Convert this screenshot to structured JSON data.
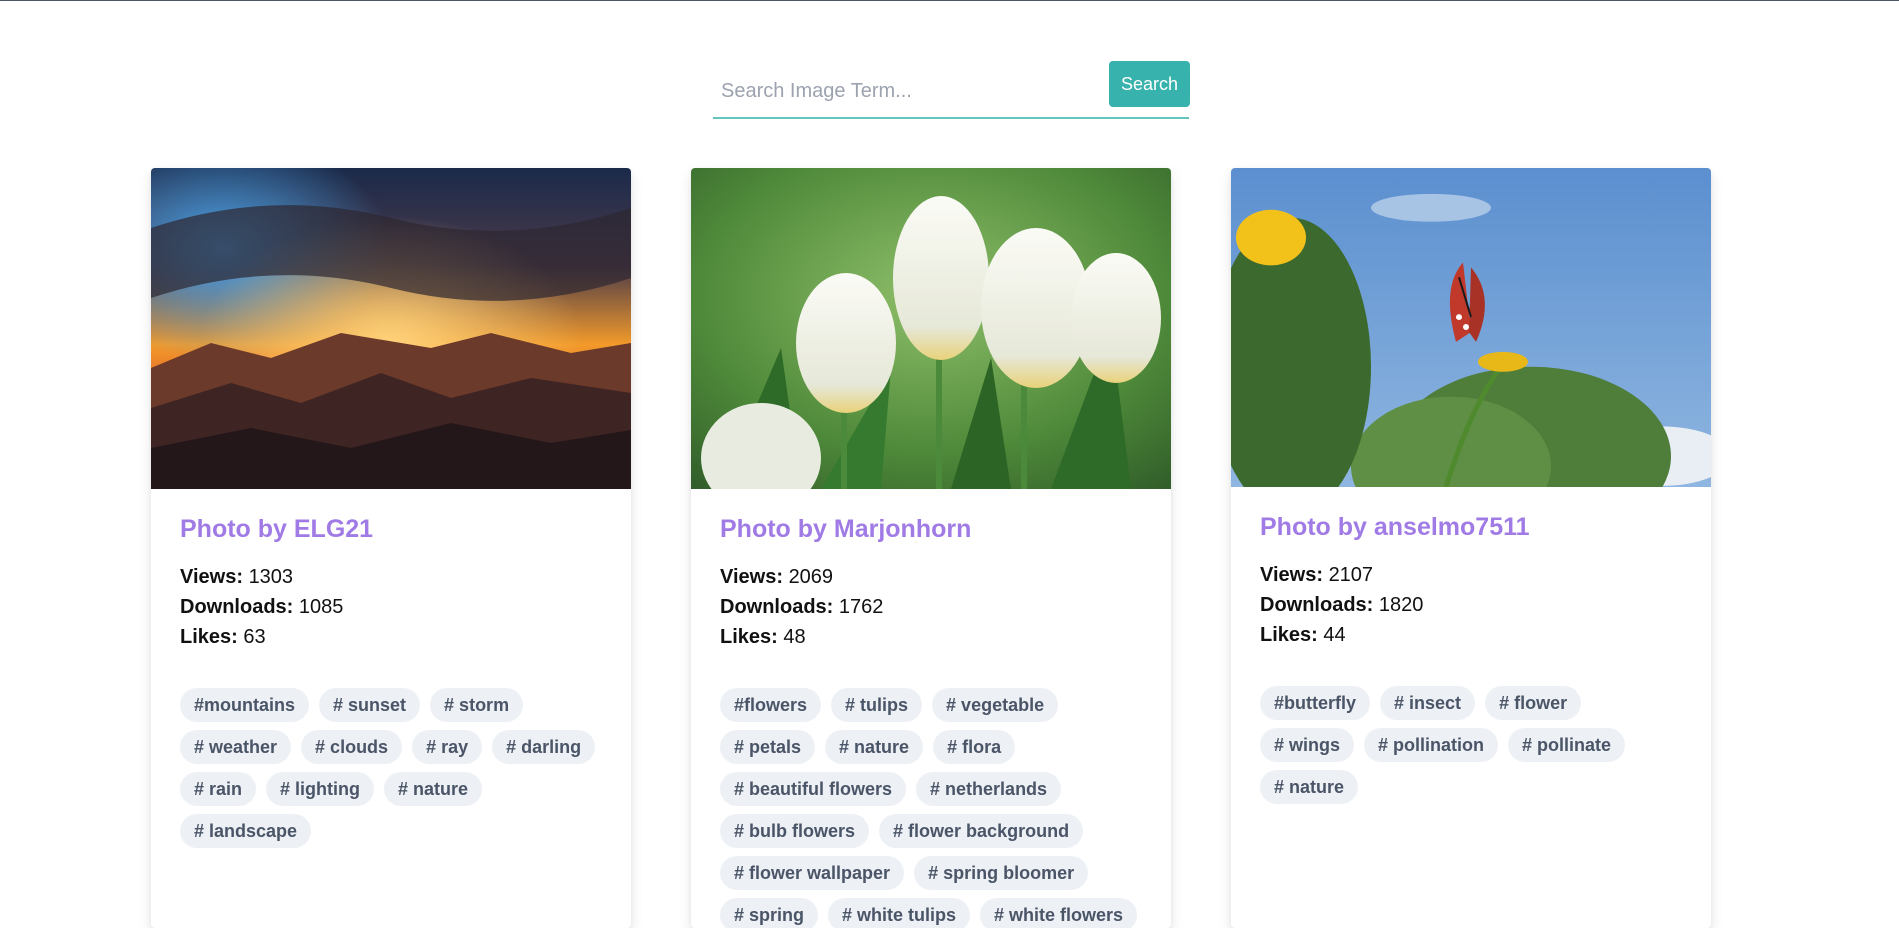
{
  "search": {
    "placeholder": "Search Image Term...",
    "button_label": "Search"
  },
  "cards": [
    {
      "title": "Photo by ELG21",
      "views_label": "Views:",
      "views": "1303",
      "downloads_label": "Downloads:",
      "downloads": "1085",
      "likes_label": "Likes:",
      "likes": "63",
      "tags": [
        "#mountains",
        "# sunset",
        "# storm",
        "# weather",
        "# clouds",
        "# ray",
        "# darling",
        "# rain",
        "# lighting",
        "# nature",
        "# landscape"
      ]
    },
    {
      "title": "Photo by Marjonhorn",
      "views_label": "Views:",
      "views": "2069",
      "downloads_label": "Downloads:",
      "downloads": "1762",
      "likes_label": "Likes:",
      "likes": "48",
      "tags": [
        "#flowers",
        "# tulips",
        "# vegetable",
        "# petals",
        "# nature",
        "# flora",
        "# beautiful flowers",
        "# netherlands",
        "# bulb flowers",
        "# flower background",
        "# flower wallpaper",
        "# spring bloomer",
        "# spring",
        "# white tulips",
        "# white flowers"
      ]
    },
    {
      "title": "Photo by anselmo7511",
      "views_label": "Views:",
      "views": "2107",
      "downloads_label": "Downloads:",
      "downloads": "1820",
      "likes_label": "Likes:",
      "likes": "44",
      "tags": [
        "#butterfly",
        "# insect",
        "# flower",
        "# wings",
        "# pollination",
        "# pollinate",
        "# nature"
      ]
    }
  ]
}
